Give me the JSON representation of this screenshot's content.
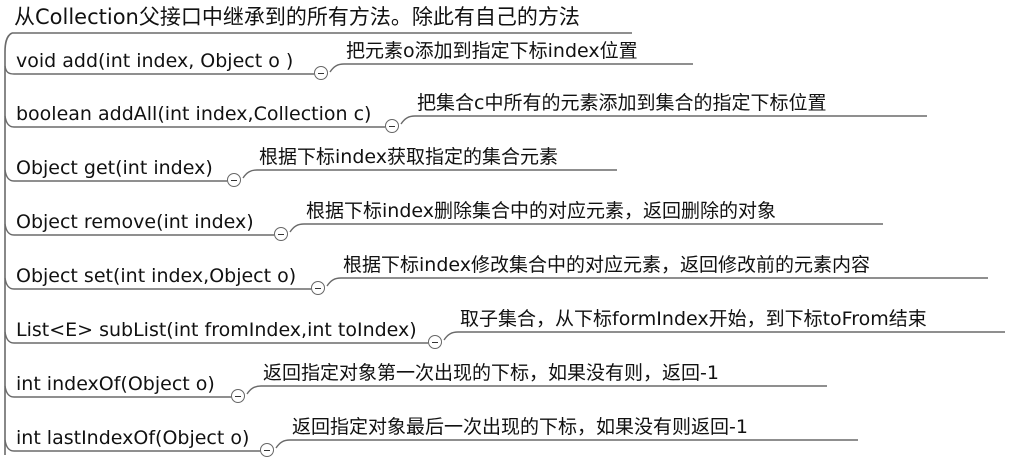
{
  "title": "从Collection父接口中继承到的所有方法。除此有自己的方法",
  "methods": [
    {
      "signature": "void  add(int  index, Object  o )",
      "description": "把元素o添加到指定下标index位置"
    },
    {
      "signature": "boolean  addAll(int index,Collection  c)",
      "description": "把集合c中所有的元素添加到集合的指定下标位置"
    },
    {
      "signature": "Object  get(int  index)",
      "description": "根据下标index获取指定的集合元素"
    },
    {
      "signature": "Object   remove(int  index)",
      "description": "根据下标index删除集合中的对应元素，返回删除的对象"
    },
    {
      "signature": "Object set(int  index,Object  o)",
      "description": "根据下标index修改集合中的对应元素，返回修改前的元素内容"
    },
    {
      "signature": "List<E>  subList(int  fromIndex,int  toIndex)",
      "description": "取子集合，从下标formIndex开始，到下标toFrom结束"
    },
    {
      "signature": "int  indexOf(Object  o)",
      "description": "返回指定对象第一次出现的下标，如果没有则，返回-1"
    },
    {
      "signature": "int lastIndexOf(Object  o)",
      "description": "返回指定对象最后一次出现的下标，如果没有则返回-1"
    }
  ],
  "colors": {
    "line": "#6a6a6a",
    "text": "#111111"
  },
  "icons": {
    "collapse": "collapse-minus-icon"
  }
}
